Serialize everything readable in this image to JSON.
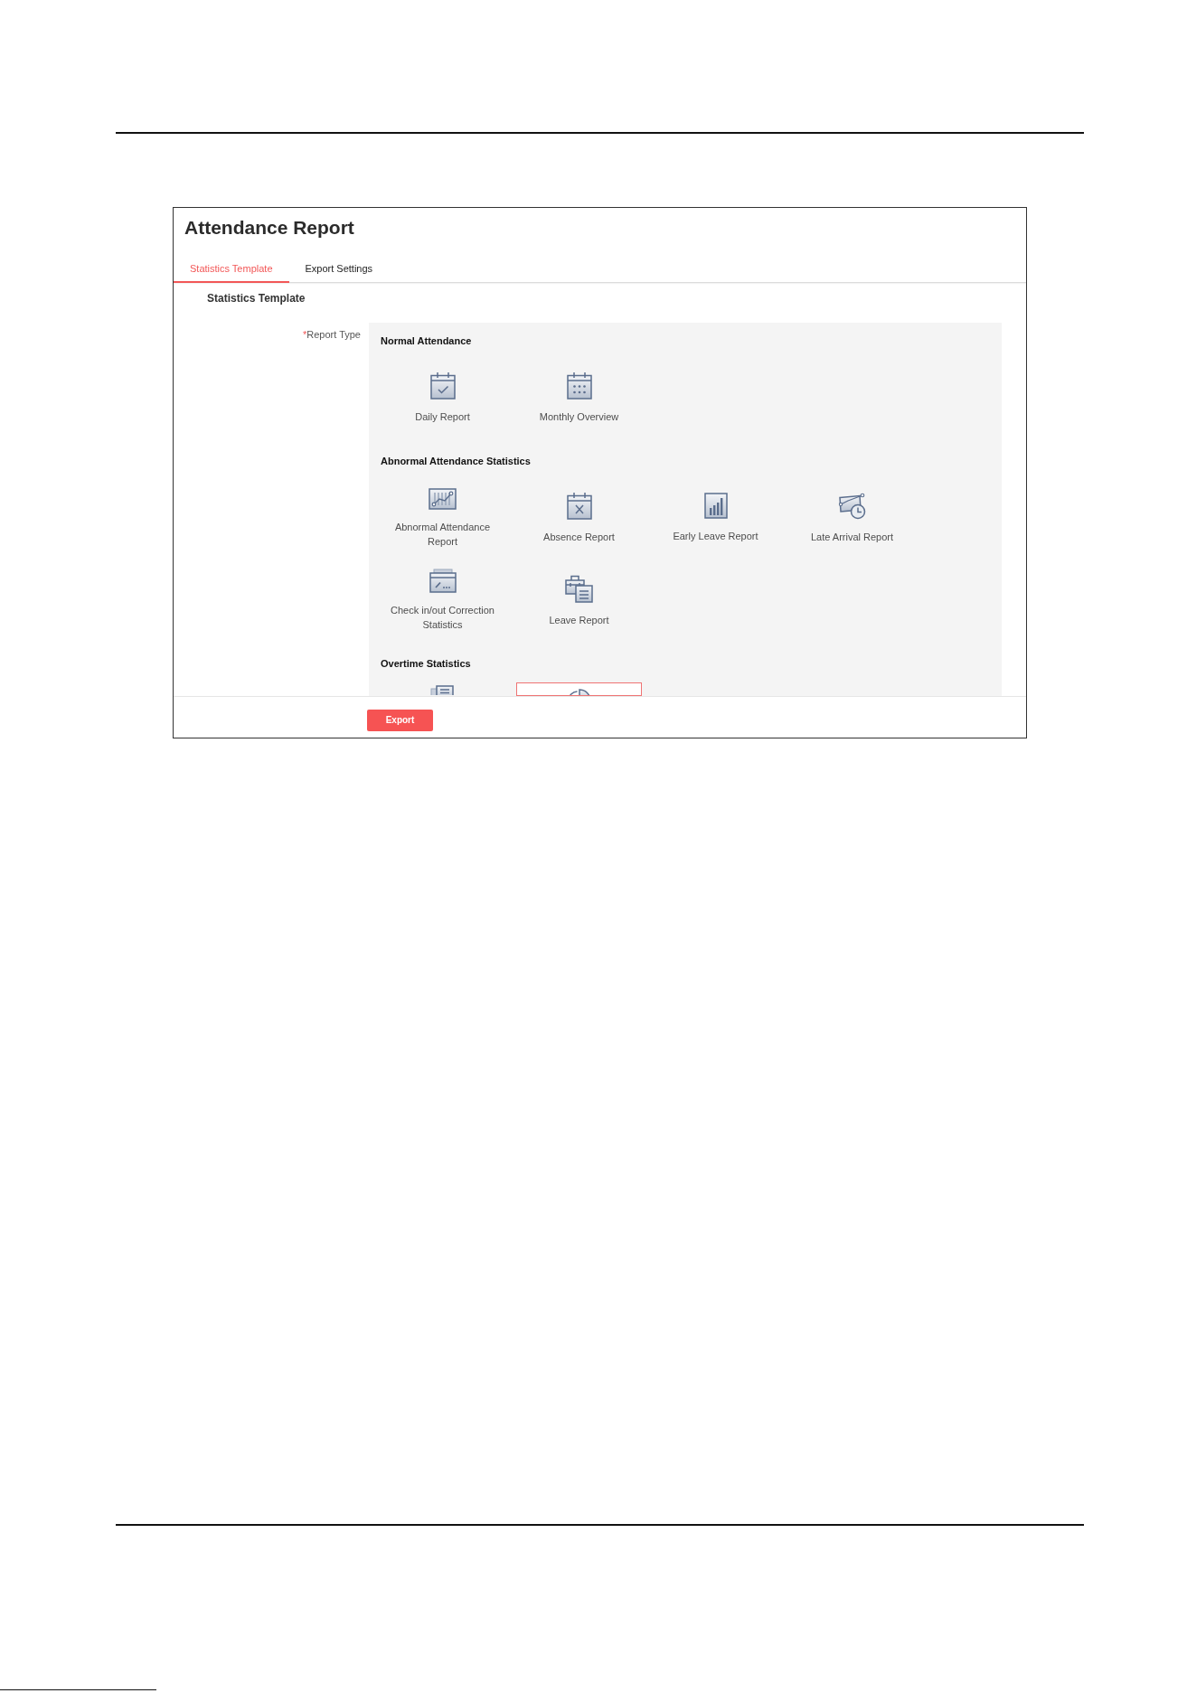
{
  "window": {
    "title": "Attendance Report"
  },
  "tabs": [
    {
      "label": "Statistics Template",
      "selected": true
    },
    {
      "label": "Export Settings",
      "selected": false
    }
  ],
  "form": {
    "heading": "Statistics Template",
    "field": {
      "required_mark": "*",
      "label": "Report Type"
    },
    "sections": [
      {
        "title": "Normal Attendance",
        "items": [
          {
            "label": "Daily Report",
            "selected": false
          },
          {
            "label": "Monthly Overview",
            "selected": false
          }
        ]
      },
      {
        "title": "Abnormal Attendance Statistics",
        "items": [
          {
            "label": "Abnormal Attendance Report",
            "selected": false
          },
          {
            "label": "Absence Report",
            "selected": false
          },
          {
            "label": "Early Leave Report",
            "selected": false
          },
          {
            "label": "Late Arrival Report",
            "selected": false
          },
          {
            "label": "Check in/out Correction Statistics",
            "selected": false
          },
          {
            "label": "Leave Report",
            "selected": false
          }
        ]
      },
      {
        "title": "Overtime Statistics",
        "items": [
          {
            "selected": false
          },
          {
            "selected": true
          }
        ]
      }
    ]
  },
  "footer": {
    "export_button": "Export"
  }
}
